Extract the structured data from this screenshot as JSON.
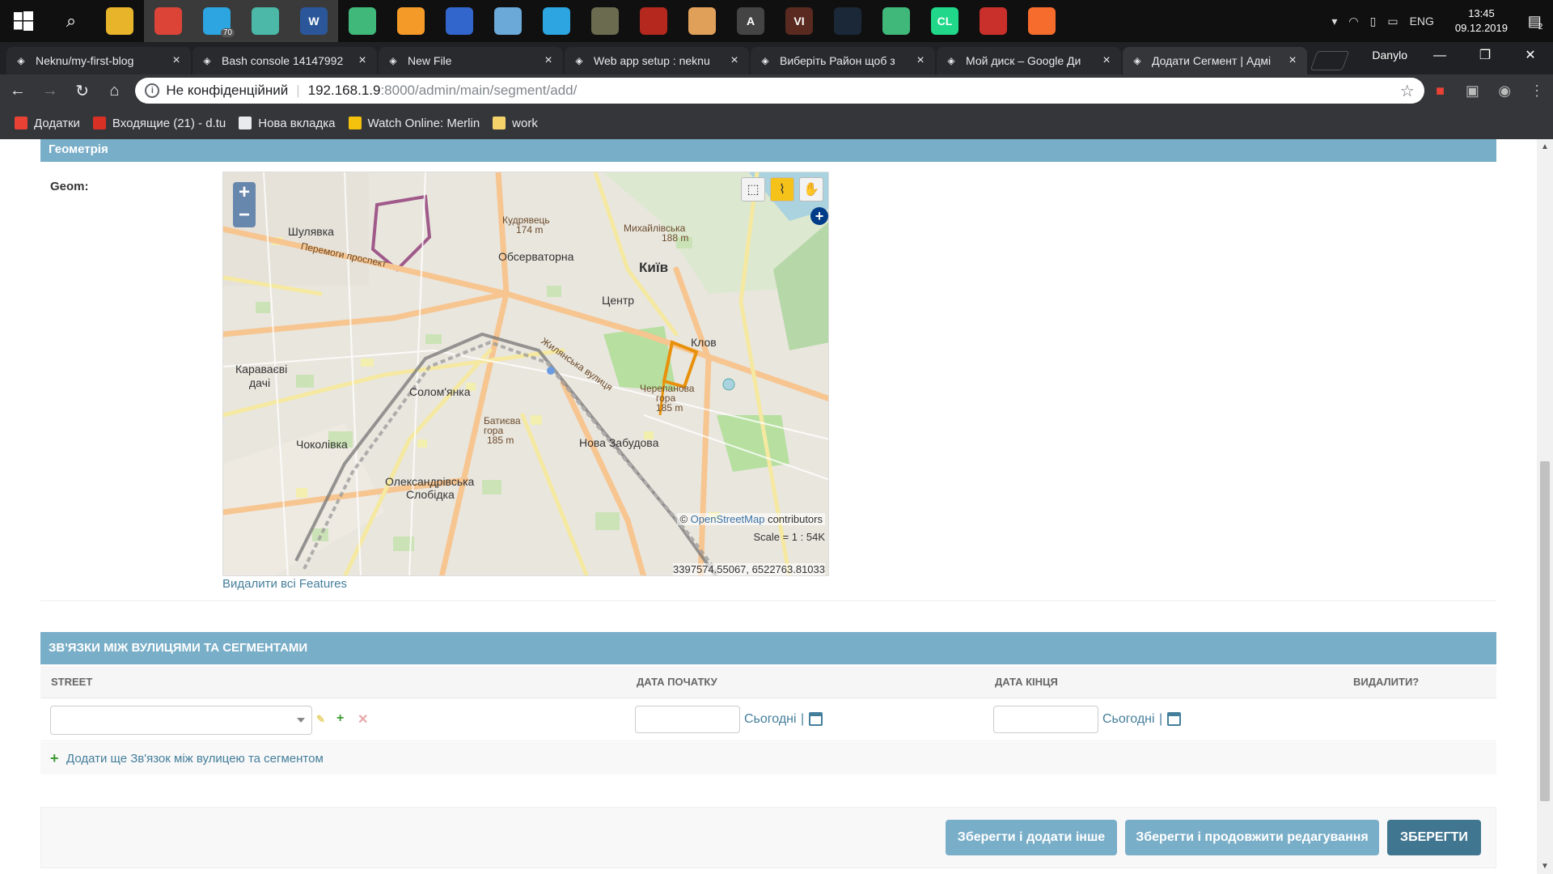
{
  "taskbar": {
    "apps": [
      {
        "name": "file-explorer",
        "color": "#e8b52a",
        "active": false
      },
      {
        "name": "chrome",
        "color": "#db4437",
        "active": true
      },
      {
        "name": "telegram",
        "color": "#2ca5e0",
        "badge": "70",
        "active": true
      },
      {
        "name": "git-kraken",
        "color": "#4bb8a8",
        "active": true
      },
      {
        "name": "word",
        "color": "#2b579a",
        "label": "W",
        "active": true
      },
      {
        "name": "atom",
        "color": "#40b87a",
        "active": false
      },
      {
        "name": "sublime",
        "color": "#f49a28",
        "active": false
      },
      {
        "name": "network",
        "color": "#3366cc",
        "active": false
      },
      {
        "name": "paint",
        "color": "#6aa9d8",
        "active": false
      },
      {
        "name": "telegram2",
        "color": "#2ca5e0",
        "active": false
      },
      {
        "name": "tank-game",
        "color": "#6b6b50",
        "active": false
      },
      {
        "name": "dota",
        "color": "#b4281e",
        "active": false
      },
      {
        "name": "character",
        "color": "#e0a05a",
        "active": false
      },
      {
        "name": "inkscape",
        "color": "#444444",
        "label": "A",
        "active": false
      },
      {
        "name": "vi",
        "color": "#5a2a20",
        "label": "VI",
        "active": false
      },
      {
        "name": "steam",
        "color": "#1b2838",
        "active": false
      },
      {
        "name": "atom2",
        "color": "#40b87a",
        "active": false
      },
      {
        "name": "clion",
        "color": "#21d789",
        "label": "CL",
        "active": false
      },
      {
        "name": "app-red",
        "color": "#c9302c",
        "active": false
      },
      {
        "name": "origin",
        "color": "#f56c2d",
        "active": false
      }
    ],
    "language": "ENG",
    "time": "13:45",
    "date": "09.12.2019",
    "notifications": "2"
  },
  "browser": {
    "tabs": [
      {
        "title": "Neknu/my-first-blog",
        "icon": "github-icon"
      },
      {
        "title": "Bash console 14147992",
        "icon": "pythonanywhere-icon"
      },
      {
        "title": "New File",
        "icon": "github-icon"
      },
      {
        "title": "Web app setup : neknu",
        "icon": "pythonanywhere-icon"
      },
      {
        "title": "Виберіть Район щоб з",
        "icon": "document-icon"
      },
      {
        "title": "Мой диск – Google Ди",
        "icon": "google-drive-icon"
      },
      {
        "title": "Додати Сегмент | Адмі",
        "icon": "document-icon",
        "active": true
      }
    ],
    "profile": "Danylo",
    "address": {
      "security": "Не конфіденційний",
      "host": "192.168.1.9",
      "path": ":8000/admin/main/segment/add/"
    },
    "bookmarks": [
      {
        "label": "Додатки",
        "icon": "apps-icon",
        "color": "#e94235"
      },
      {
        "label": "Входящие (21) - d.tu",
        "icon": "gmail-icon",
        "color": "#d93025"
      },
      {
        "label": "Нова вкладка",
        "icon": "home-icon",
        "color": "#e8eaed"
      },
      {
        "label": "Watch Online: Merlin",
        "icon": "play-icon",
        "color": "#f4c20d"
      },
      {
        "label": "work",
        "icon": "folder-icon",
        "color": "#f6d26b"
      }
    ]
  },
  "form": {
    "geometry_section": "Геометрія",
    "geom_label": "Geom:",
    "map": {
      "attribution_prefix": "© ",
      "attribution_link": "OpenStreetMap",
      "attribution_suffix": " contributors",
      "scale": "Scale = 1 : 54K",
      "coords": "3397574.55067, 6522763.81033",
      "labels": [
        {
          "text": "Шулявка",
          "cls": ""
        },
        {
          "text": "Перемоги проспект",
          "cls": "small"
        },
        {
          "text": "Кудрявець",
          "cls": "small"
        },
        {
          "text": "174 m",
          "cls": "small"
        },
        {
          "text": "Михайлівська",
          "cls": "small"
        },
        {
          "text": "188 m",
          "cls": "small"
        },
        {
          "text": "Обсерваторна",
          "cls": ""
        },
        {
          "text": "Київ",
          "cls": "big"
        },
        {
          "text": "Центр",
          "cls": ""
        },
        {
          "text": "Клов",
          "cls": ""
        },
        {
          "text": "Караваєві",
          "cls": ""
        },
        {
          "text": "дачі",
          "cls": ""
        },
        {
          "text": "Солом'янка",
          "cls": ""
        },
        {
          "text": "Черепанова",
          "cls": "small"
        },
        {
          "text": "гора",
          "cls": "small"
        },
        {
          "text": "185 m",
          "cls": "small"
        },
        {
          "text": "Батиєва",
          "cls": "small"
        },
        {
          "text": "гора",
          "cls": "small"
        },
        {
          "text": "185 m",
          "cls": "small"
        },
        {
          "text": "Нова Забудова",
          "cls": ""
        },
        {
          "text": "Чоколівка",
          "cls": ""
        },
        {
          "text": "Олександрівська",
          "cls": ""
        },
        {
          "text": "Слобідка",
          "cls": ""
        },
        {
          "text": "Жилянська вулиця",
          "cls": "small"
        }
      ]
    },
    "delete_features": "Видалити всі Features",
    "inline_section": "ЗВ'ЯЗКИ МІЖ ВУЛИЦЯМИ ТА СЕГМЕНТАМИ",
    "columns": {
      "street": "STREET",
      "start": "ДАТА ПОЧАТКУ",
      "end": "ДАТА КІНЦЯ",
      "delete": "ВИДАЛИТИ?"
    },
    "row": {
      "today_start": "Сьогодні",
      "today_end": "Сьогодні",
      "pipe": "|"
    },
    "add_another": "Додати ще Зв'язок між вулицею та сегментом",
    "buttons": {
      "save_add": "Зберегти і додати інше",
      "save_continue": "Зберегти і продовжити редагування",
      "save": "ЗБЕРЕГТИ"
    }
  }
}
